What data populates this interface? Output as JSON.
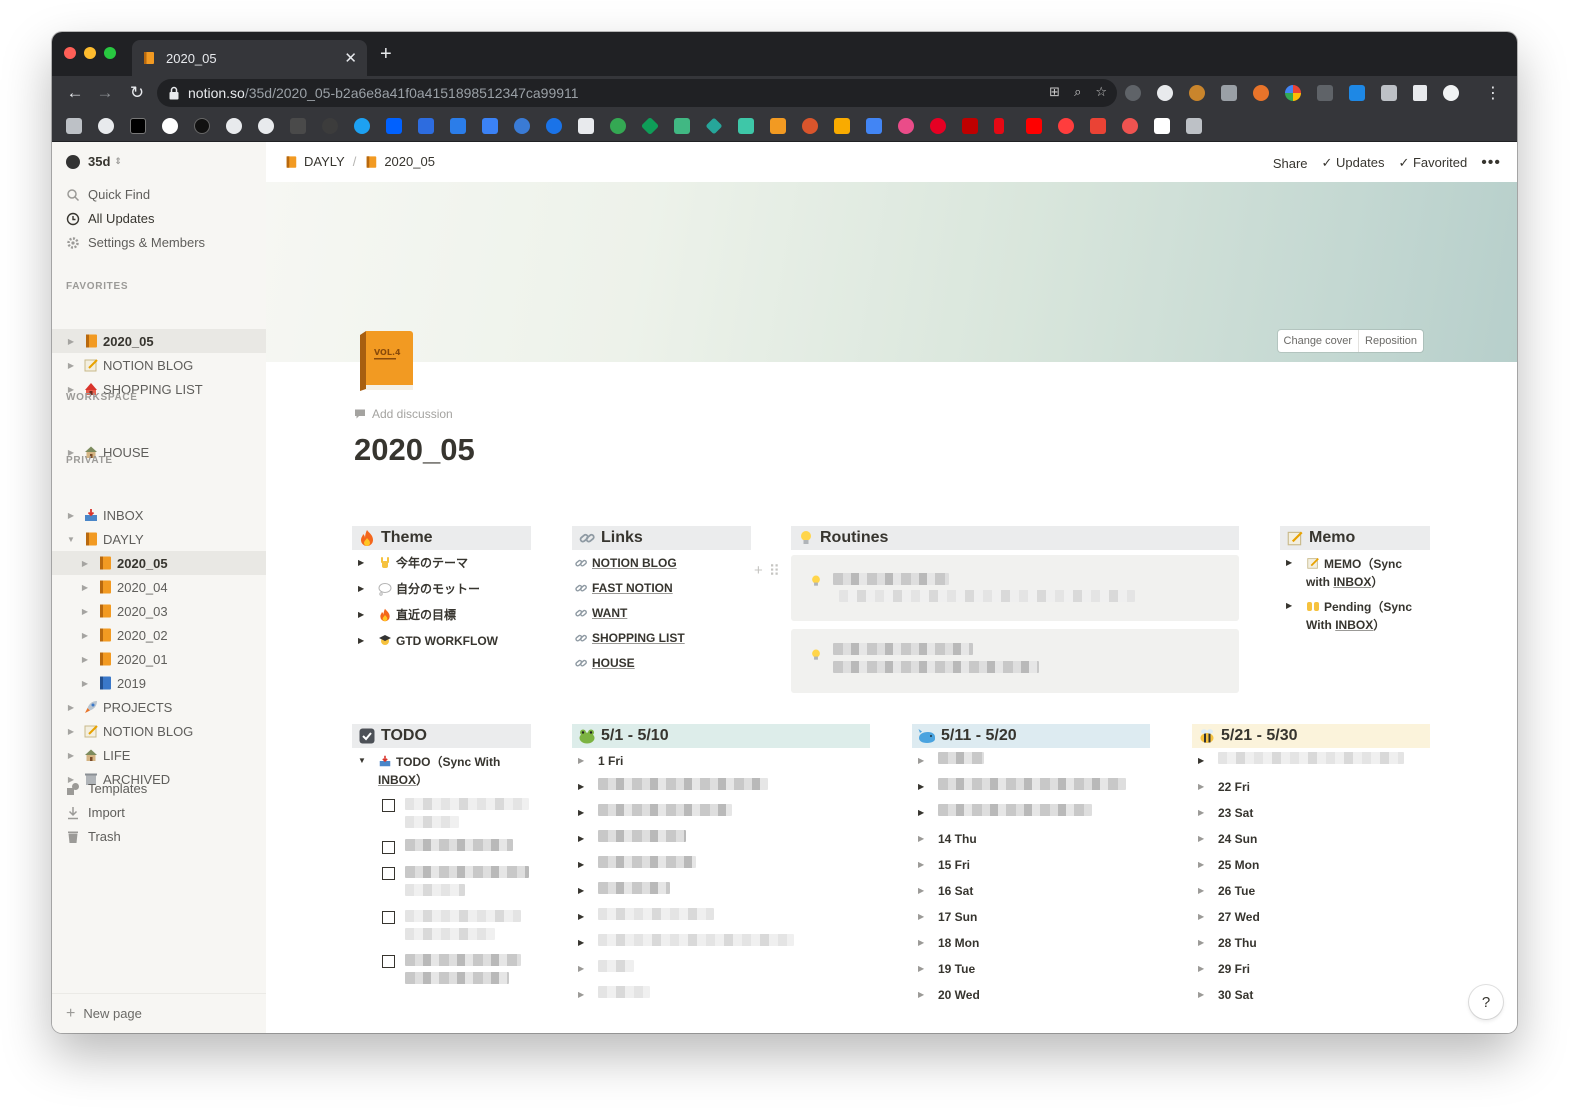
{
  "browser": {
    "tab_title": "2020_05",
    "url_host": "notion.so",
    "url_path": "/35d/2020_05-b2a6e8a41f0a4151898512347ca99911"
  },
  "sidebar": {
    "workspace": "35d",
    "quick_find": "Quick Find",
    "all_updates": "All Updates",
    "settings": "Settings & Members",
    "favorites_label": "FAVORITES",
    "favorites": [
      "2020_05",
      "NOTION BLOG",
      "SHOPPING LIST"
    ],
    "workspace_label": "WORKSPACE",
    "workspace_items": [
      "HOUSE"
    ],
    "private_label": "PRIVATE",
    "private_items": [
      "INBOX",
      "DAYLY",
      "2020_05",
      "2020_04",
      "2020_03",
      "2020_02",
      "2020_01",
      "2019",
      "PROJECTS",
      "NOTION BLOG",
      "LIFE",
      "ARCHIVED"
    ],
    "templates": "Templates",
    "import": "Import",
    "trash": "Trash",
    "new_page": "New page"
  },
  "topbar": {
    "crumbs": [
      "DAYLY",
      "2020_05"
    ],
    "share": "Share",
    "updates": "Updates",
    "favorited": "Favorited"
  },
  "cover": {
    "change": "Change cover",
    "reposition": "Reposition"
  },
  "page": {
    "add_discussion": "Add discussion",
    "title": "2020_05"
  },
  "theme": {
    "heading": "Theme",
    "items": [
      "今年のテーマ",
      "自分のモットー",
      "直近の目標",
      "GTD WORKFLOW"
    ]
  },
  "links": {
    "heading": "Links",
    "items": [
      "NOTION BLOG",
      "FAST NOTION",
      "WANT",
      "SHOPPING LIST",
      "HOUSE"
    ]
  },
  "routines": {
    "heading": "Routines"
  },
  "memo": {
    "heading": "Memo",
    "item1_a": "MEMO（Sync",
    "item1_b": "with ",
    "item1_link": "INBOX",
    "item1_c": "）",
    "item2_a": "Pending（Sync",
    "item2_b": "With ",
    "item2_link": "INBOX",
    "item2_c": "）"
  },
  "todo": {
    "heading": "TODO",
    "toggle_a": "TODO（Sync With",
    "toggle_link": "INBOX",
    "toggle_c": "）"
  },
  "range1": {
    "heading": "5/1 - 5/10",
    "first": "1 Fri"
  },
  "range2": {
    "heading": "5/11 - 5/20",
    "days": [
      "14 Thu",
      "15 Fri",
      "16 Sat",
      "17 Sun",
      "18 Mon",
      "19 Tue",
      "20 Wed"
    ]
  },
  "range3": {
    "heading": "5/21 - 5/30",
    "days": [
      "22 Fri",
      "23 Sat",
      "24 Sun",
      "25 Mon",
      "26 Tue",
      "27 Wed",
      "28 Thu",
      "29 Fri",
      "30 Sat"
    ]
  },
  "help": "?"
}
